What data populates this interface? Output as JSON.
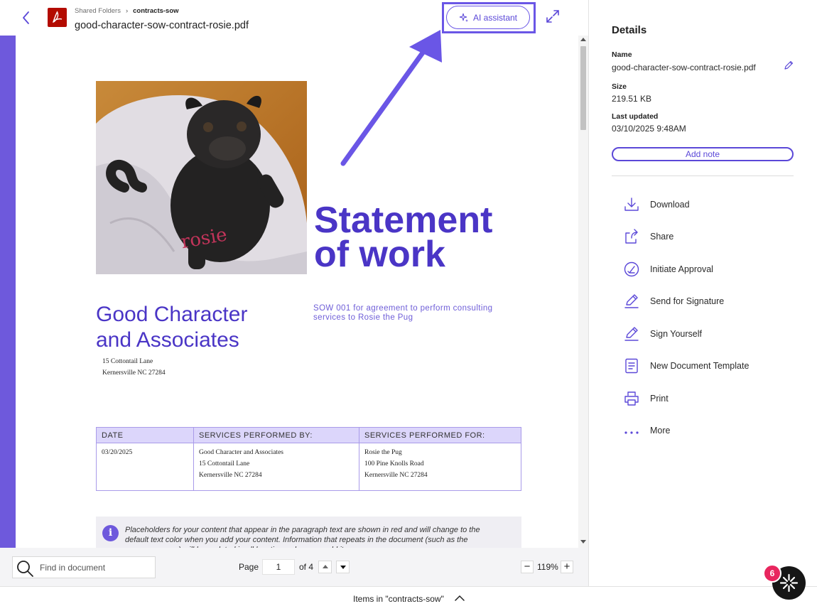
{
  "header": {
    "breadcrumb": [
      "Shared Folders",
      "contracts-sow"
    ],
    "file_name": "good-character-sow-contract-rosie.pdf",
    "ai_button_label": "AI assistant"
  },
  "document": {
    "title": "Statement of work",
    "company_name": "Good Character and Associates",
    "sow_description": "SOW 001 for agreement to perform consulting services to Rosie the Pug",
    "company_address": [
      "15 Cottontail Lane",
      "Kernersville NC 27284"
    ],
    "photo_caption_text": "rosie",
    "services_table": {
      "headers": [
        "DATE",
        "SERVICES PERFORMED BY:",
        "SERVICES PERFORMED FOR:"
      ],
      "rows": [
        [
          "03/20/2025"
        ],
        [
          "Good Character and Associates",
          "15 Cottontail Lane",
          "Kernersville NC 27284"
        ],
        [
          "Rosie the Pug",
          "100 Pine Knolls Road",
          "Kernersville NC 27284"
        ]
      ]
    },
    "info_note": "Placeholders for your content that appear in the paragraph text are shown in red and will change to the default text color when you add your content. Information that repeats in the document (such as the company name) will be updated in all locations when you add it."
  },
  "toolbar": {
    "find_placeholder": "Find in document",
    "page_label": "Page",
    "current_page": "1",
    "page_count_label": "of 4",
    "zoom_level": "119%"
  },
  "details": {
    "title": "Details",
    "name_label": "Name",
    "name_value": "good-character-sow-contract-rosie.pdf",
    "size_label": "Size",
    "size_value": "219.51 KB",
    "updated_label": "Last updated",
    "updated_value": "03/10/2025 9:48AM",
    "add_note_label": "Add note",
    "actions": [
      {
        "label": "Download",
        "icon": "download-icon"
      },
      {
        "label": "Share",
        "icon": "share-icon"
      },
      {
        "label": "Initiate Approval",
        "icon": "approval-icon"
      },
      {
        "label": "Send for Signature",
        "icon": "pen-icon"
      },
      {
        "label": "Sign Yourself",
        "icon": "pen-icon"
      },
      {
        "label": "New Document Template",
        "icon": "document-icon"
      },
      {
        "label": "Print",
        "icon": "printer-icon"
      },
      {
        "label": "More",
        "icon": "more-icon"
      }
    ]
  },
  "footer": {
    "items_label": "Items in \"contracts-sow\""
  },
  "assistant_badge_count": "6",
  "colors": {
    "accent": "#6e59dc",
    "accent_dark": "#4a35c6",
    "annotation": "#6a56e6",
    "pdf_red": "#b30b00",
    "badge": "#e8265e"
  }
}
